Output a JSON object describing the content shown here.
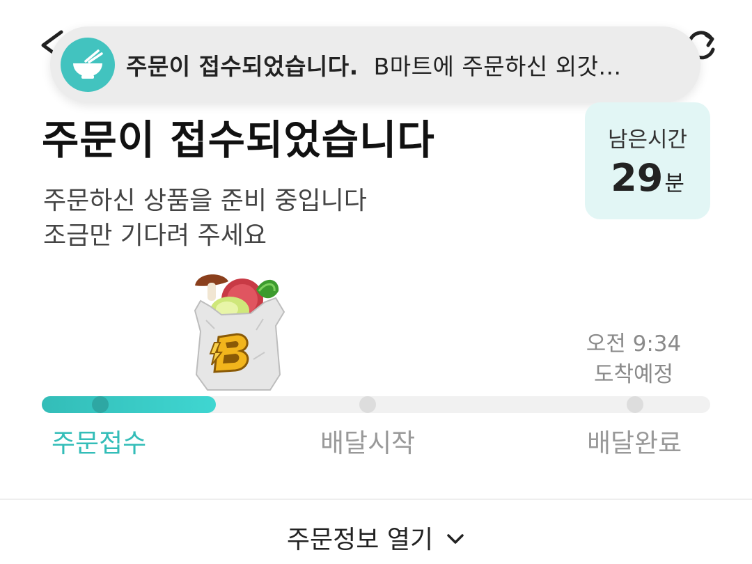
{
  "toast": {
    "title": "주문이 접수되었습니다.",
    "body": "B마트에 주문하신 외갓...",
    "icon": "bowl-icon"
  },
  "header": {
    "back_icon": "chevron-left-icon",
    "refresh_icon": "refresh-icon"
  },
  "status": {
    "title": "주문이 접수되었습니다",
    "subtitle_line1": "주문하신 상품을 준비 중입니다",
    "subtitle_line2": "조금만 기다려 주세요"
  },
  "remaining": {
    "label": "남은시간",
    "value": "29",
    "unit": "분"
  },
  "eta": {
    "time": "오전 9:34",
    "label": "도착예정"
  },
  "progress": {
    "fraction": 0.26,
    "steps": [
      {
        "label": "주문접수",
        "active": true
      },
      {
        "label": "배달시작",
        "active": false
      },
      {
        "label": "배달완료",
        "active": false
      }
    ]
  },
  "order_info": {
    "open_label": "주문정보 열기",
    "icon": "chevron-down-icon"
  },
  "colors": {
    "accent": "#33bdb8",
    "accent_light": "#e2f6f5",
    "inactive": "#999999"
  }
}
